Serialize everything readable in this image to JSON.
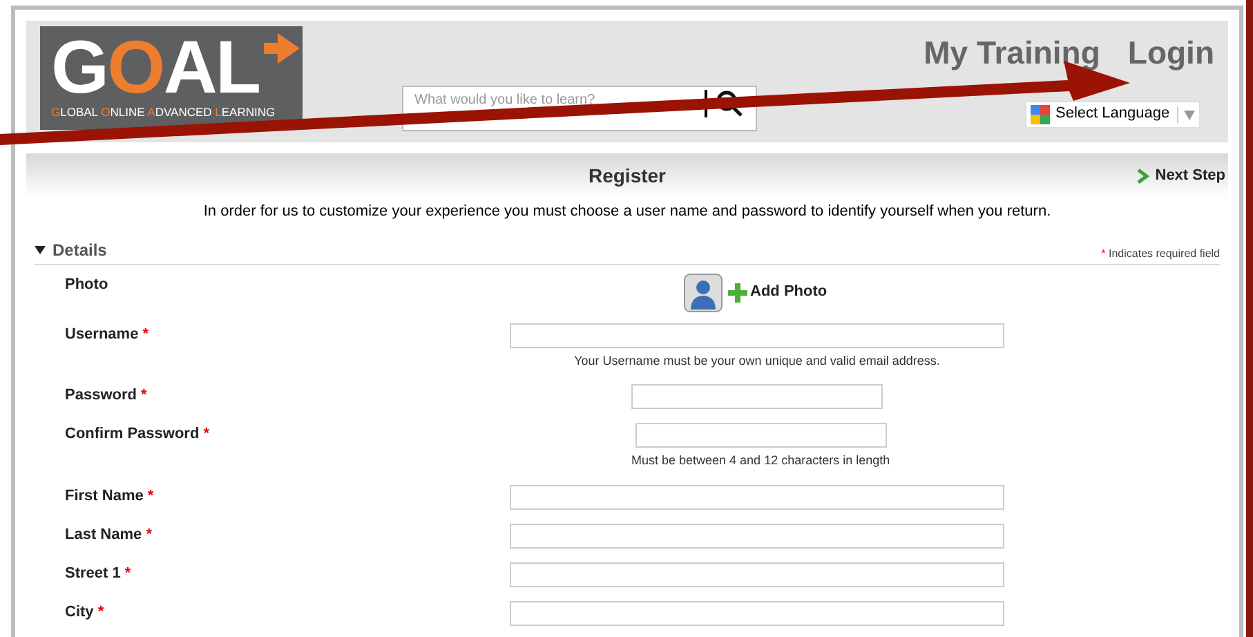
{
  "logo": {
    "wordmark": "GOAL",
    "tagline": "GLOBAL ONLINE ADVANCED LEARNING"
  },
  "search": {
    "placeholder": "What would you like to learn?"
  },
  "nav": [
    "My Training",
    "Login"
  ],
  "language": {
    "label": "Select Language"
  },
  "register": {
    "title": "Register",
    "next": "Next Step",
    "intro": "In order for us to customize your experience you must choose a user name and password to identify yourself when you return."
  },
  "section": {
    "title": "Details",
    "expanded": true,
    "required_note": "Indicates required field",
    "required_mark": "*"
  },
  "photo": {
    "label": "Photo",
    "action": "Add Photo"
  },
  "fields": [
    {
      "label": "Username",
      "required": true,
      "kind": "wide",
      "hint": "Your Username must be your own unique and valid email address."
    },
    {
      "label": "Password",
      "required": true,
      "kind": "short"
    },
    {
      "label": "Confirm Password",
      "required": true,
      "kind": "short",
      "hint": "Must be between 4 and 12 characters in length"
    },
    {
      "label": "First Name",
      "required": true,
      "kind": "wide"
    },
    {
      "label": "Last Name",
      "required": true,
      "kind": "wide"
    },
    {
      "label": "Street 1",
      "required": true,
      "kind": "wide"
    },
    {
      "label": "City",
      "required": true,
      "kind": "wide"
    }
  ]
}
